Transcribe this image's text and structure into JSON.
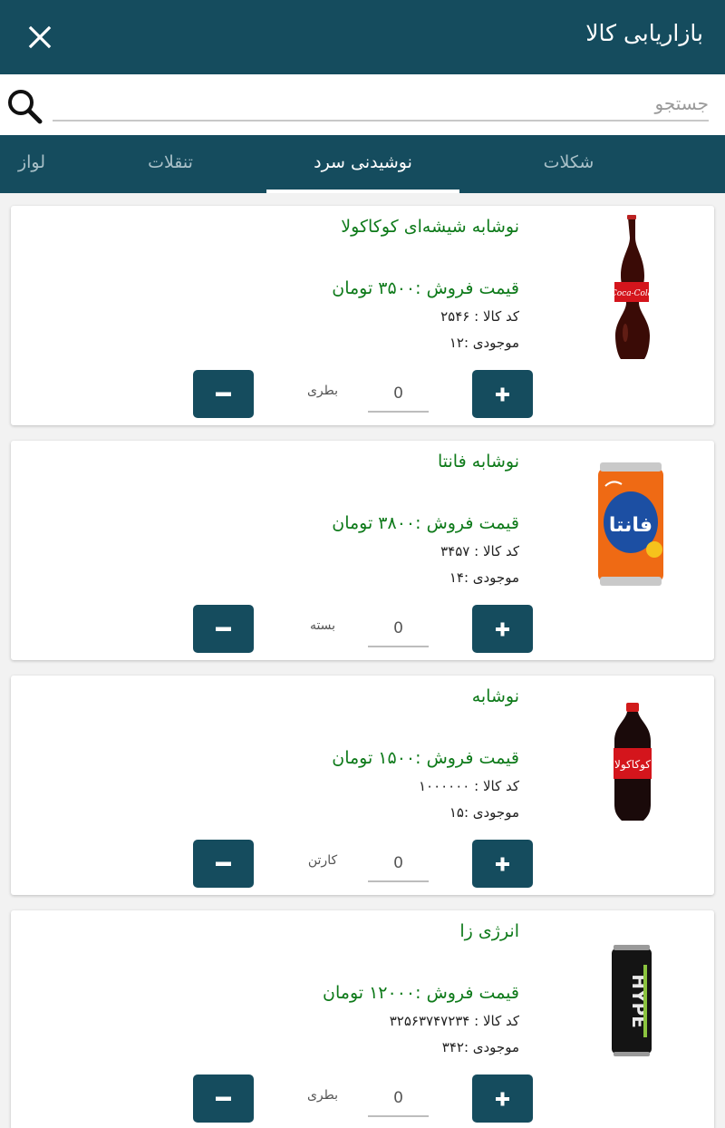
{
  "header": {
    "title": "بازاریابی کالا",
    "close_icon": "close-icon"
  },
  "search": {
    "placeholder": "جستجو",
    "value": "",
    "icon": "search-icon"
  },
  "tabs": [
    {
      "label": "شکلات",
      "active": false
    },
    {
      "label": "نوشیدنی سرد",
      "active": true
    },
    {
      "label": "تنقلات",
      "active": false
    },
    {
      "label": "لواز",
      "active": false
    }
  ],
  "products": [
    {
      "name": "نوشابه شیشه‌ای کوکاکولا",
      "price": "قیمت فروش :۳۵۰۰ تومان",
      "code": "کد کالا : ۲۵۴۶",
      "stock": "موجودی :۱۲",
      "unit": "بطری",
      "quantity": "0",
      "image": "coca-cola-glass-bottle"
    },
    {
      "name": "نوشابه فانتا",
      "price": "قیمت فروش :۳۸۰۰ تومان",
      "code": "کد کالا : ۳۴۵۷",
      "stock": "موجودی :۱۴",
      "unit": "بسته",
      "quantity": "0",
      "image": "fanta-can"
    },
    {
      "name": "نوشابه",
      "price": "قیمت فروش :۱۵۰۰ تومان",
      "code": "کد کالا : ۱۰۰۰۰۰۰",
      "stock": "موجودی :۱۵",
      "unit": "کارتن",
      "quantity": "0",
      "image": "coca-cola-plastic-bottle"
    },
    {
      "name": "انرژی زا",
      "price": "قیمت فروش :۱۲۰۰۰ تومان",
      "code": "کد کالا : ۳۲۵۶۳۷۴۷۲۳۴",
      "stock": "موجودی :۳۴۲",
      "unit": "بطری",
      "quantity": "0",
      "image": "hype-energy-can"
    }
  ],
  "buttons": {
    "plus_icon": "plus-icon",
    "minus_icon": "minus-icon"
  },
  "colors": {
    "primary": "#154c5e",
    "price_green": "#0e7a1a",
    "tab_inactive": "#a9c0c8"
  }
}
